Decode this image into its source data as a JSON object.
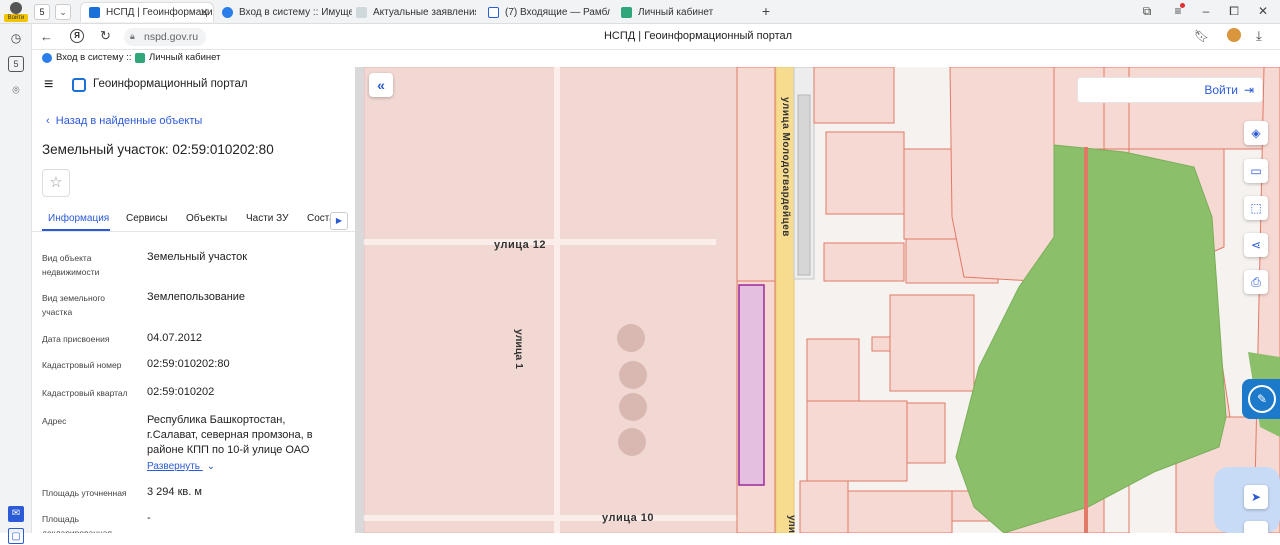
{
  "browser": {
    "profile_badge": "Войти",
    "tab_counter": "5",
    "tabs": [
      {
        "label": "НСПД | Геоинформацио",
        "active": true
      },
      {
        "label": "Вход в систему :: Имущес"
      },
      {
        "label": "Актуальные заявления"
      },
      {
        "label": "(7) Входящие — Рамблер"
      },
      {
        "label": "Личный кабинет"
      }
    ],
    "new_tab": "+",
    "url": "nspd.gov.ru",
    "page_title": "НСПД | Геоинформационный портал",
    "bookmarks": [
      "Вход в систему ::",
      "Личный кабинет"
    ]
  },
  "panel": {
    "portal_name": "Геоинформационный портал",
    "back_link": "Назад в найденные объекты",
    "title": "Земельный участок: 02:59:010202:80",
    "tabs": [
      "Информация",
      "Сервисы",
      "Объекты",
      "Части ЗУ",
      "Соста"
    ],
    "fields": [
      {
        "label": "Вид объекта недвижимости",
        "value": "Земельный участок"
      },
      {
        "label": "Вид земельного участка",
        "value": "Землепользование"
      },
      {
        "label": "Дата присвоения",
        "value": "04.07.2012"
      },
      {
        "label": "Кадастровый номер",
        "value": "02:59:010202:80"
      },
      {
        "label": "Кадастровый квартал",
        "value": "02:59:010202"
      },
      {
        "label": "Адрес",
        "value": "Республика Башкортостан, г.Салават, северная промзона, в районе КПП по 10-й улице ОАО"
      },
      {
        "label": "Площадь уточненная",
        "value": "3 294 кв. м"
      },
      {
        "label": "Площадь декларированная",
        "value": "-"
      }
    ],
    "expand_link": "Развернуть"
  },
  "map": {
    "login_button": "Войти",
    "streets": [
      "улица 12",
      "улица 1",
      "улица 10",
      "улица Молодогвардейцев",
      "ули"
    ],
    "colors": {
      "parcel_fill": "#f7d9d3",
      "parcel_stroke": "#e07a66",
      "selected_fill": "#e5bfe0",
      "selected_stroke": "#9c2a9c",
      "forest": "#8cbf6a",
      "road": "#f7dc8f",
      "accent": "#2a5ad7"
    }
  }
}
